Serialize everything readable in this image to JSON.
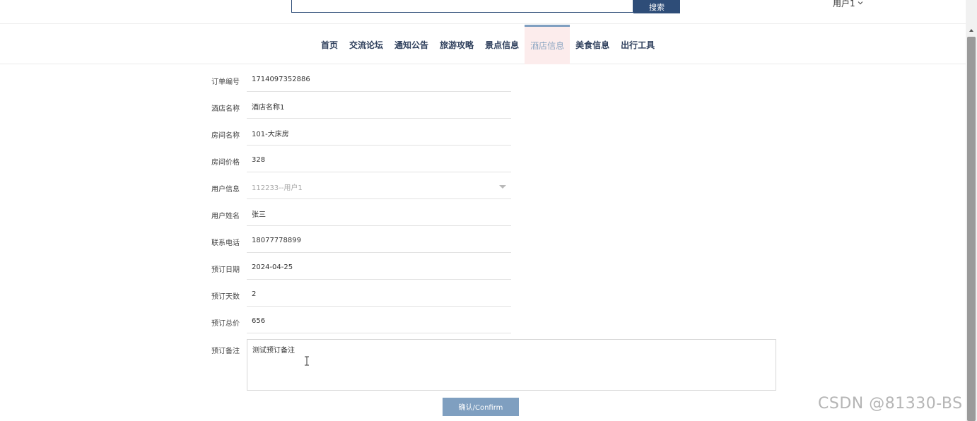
{
  "header": {
    "search_placeholder": "",
    "search_button": "搜索",
    "user_menu": "用户1"
  },
  "nav": {
    "items": [
      "首页",
      "交流论坛",
      "通知公告",
      "旅游攻略",
      "景点信息",
      "酒店信息",
      "美食信息",
      "出行工具"
    ],
    "active_index": 5
  },
  "form": {
    "fields": [
      {
        "label": "订单编号",
        "value": "1714097352886"
      },
      {
        "label": "酒店名称",
        "value": "酒店名称1"
      },
      {
        "label": "房间名称",
        "value": "101-大床房"
      },
      {
        "label": "房间价格",
        "value": "328"
      },
      {
        "label": "用户信息",
        "value": "112233--用户1"
      },
      {
        "label": "用户姓名",
        "value": "张三"
      },
      {
        "label": "联系电话",
        "value": "18077778899"
      },
      {
        "label": "预订日期",
        "value": "2024-04-25"
      },
      {
        "label": "预订天数",
        "value": "2"
      },
      {
        "label": "预订总价",
        "value": "656"
      }
    ],
    "remark_label": "预订备注",
    "remark_value": "测试预订备注",
    "confirm_button": "确认/Confirm"
  },
  "watermark": "CSDN @81330-BS",
  "colors": {
    "primary": "#2e4d78",
    "accent": "#7f9fc0",
    "active_bg": "#fcecec"
  }
}
